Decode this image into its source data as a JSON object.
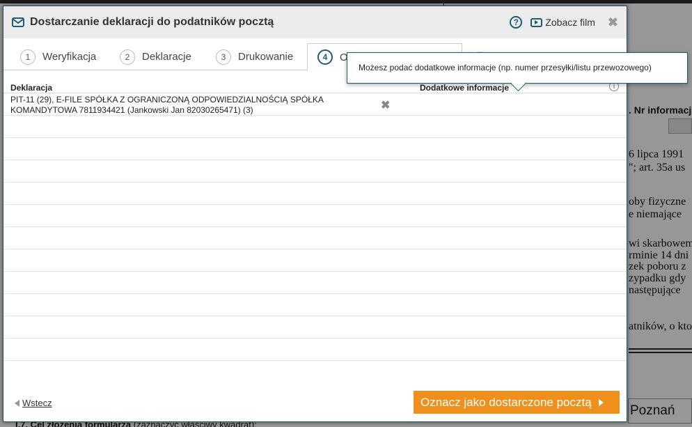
{
  "background": {
    "header_text": ". Nr informacj",
    "law_1": "6 lipca 1991",
    "law_2": "\"; art. 35a us",
    "body_1": "oby fizyczne",
    "body_2": "e niemające",
    "body_3": "wi skarbowem",
    "body_4": "rminie 14 dni",
    "body_5": "zek poboru z",
    "body_6": "zypadku gdy",
    "body_7": "następujące",
    "body_8": "atników, o kto",
    "bottom_label": "I.7. Cel złożenia formularza",
    "bottom_label_suffix": " (zaznaczyć właściwy kwadrat):",
    "city": "Poznań"
  },
  "dialog": {
    "title": "Dostarczanie deklaracji do podatników pocztą",
    "help_icon_glyph": "?",
    "film_label": "Zobacz film",
    "close_glyph": "✖"
  },
  "tabs": [
    {
      "num": "1",
      "label": "Weryfikacja"
    },
    {
      "num": "2",
      "label": "Deklaracje"
    },
    {
      "num": "3",
      "label": "Drukowanie"
    },
    {
      "num": "4",
      "label": "O"
    }
  ],
  "table": {
    "col_declaration": "Deklaracja",
    "col_additional": "Dodatkowe informacje",
    "info_icon_glyph": "i",
    "rows": [
      {
        "declaration": "PIT-11 (29), E-FILE SPÓŁKA Z OGRANICZONĄ ODPOWIEDZIALNOŚCIĄ SPÓŁKA KOMANDYTOWA 7811934421 (Jankowski Jan 82030265471) (3)",
        "remove_glyph": "✖"
      }
    ]
  },
  "tooltip": {
    "text": "Możesz podać dodatkowe informacje (np. numer przesyłki/listu przewozowego)"
  },
  "footer": {
    "back_label": "Wstecz",
    "primary_label": "Oznacz jako dostarczone pocztą"
  },
  "colors": {
    "accent": "#1f5c72",
    "primary_button": "#f0901c"
  }
}
